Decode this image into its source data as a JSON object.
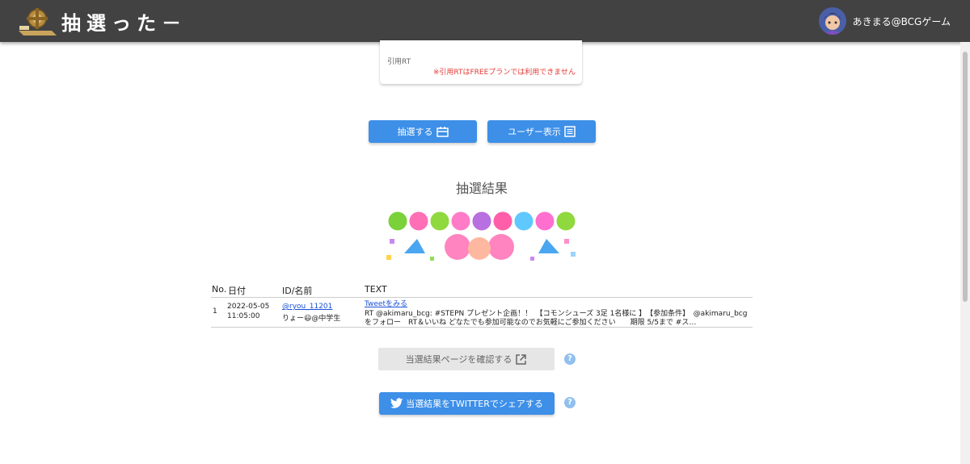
{
  "header": {
    "app_title": "抽選った－",
    "user_name": "あきまる@BCGゲーム"
  },
  "card": {
    "quote_rt_label": "引用RT",
    "quote_rt_warning": "※引用RTはFREEプランでは利用できません"
  },
  "actions": {
    "draw_label": "抽選する",
    "show_users_label": "ユーザー表示"
  },
  "result": {
    "title": "抽選結果",
    "columns": [
      "No.",
      "日付",
      "ID/名前",
      "TEXT"
    ],
    "rows": [
      {
        "no": "1",
        "date": "2022-05-05",
        "time": "11:05:00",
        "user_id": "@ryou_11201",
        "user_name": "りょー😃@中学生",
        "tweet_link": "Tweetをみる",
        "text_line1": "RT @akimaru_bcg: #STEPN プレゼント企画！！　【コモンシューズ 3足 1名様に 】　【参加条件】　@akimaru_bcg",
        "text_line2": "をフォロー　RT＆いいね どなたでも参加可能なのでお気軽にご参加ください　　期限 5/5まで #ス…"
      }
    ],
    "confirm_page_label": "当選結果ページを確認する",
    "share_twitter_label": "当選結果をTWITTERでシェアする"
  },
  "icons": {
    "draw": "calendar-ticket-icon",
    "users": "list-icon",
    "external": "open-in-new-icon",
    "help": "help-circle-icon",
    "twitter": "twitter-bird-icon"
  },
  "colors": {
    "header": "#424242",
    "primary": "#3d8fe8",
    "warning": "#e53935",
    "link": "#1a4fd6"
  }
}
